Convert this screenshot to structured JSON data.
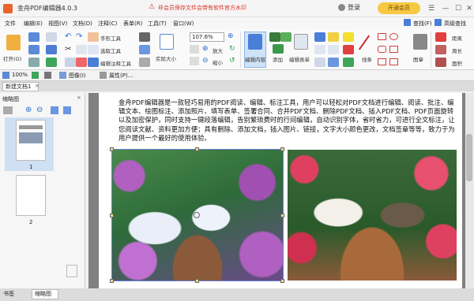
{
  "app": {
    "title": "金舟PDF编辑器4.0.3"
  },
  "watermark_notice": "非会员保存文件会带有软件官方水印",
  "header": {
    "login": "登录",
    "vip": "开通会员"
  },
  "menu": [
    "文件",
    "编辑(E)",
    "视图(V)",
    "文档(D)",
    "注释(C)",
    "表单(R)",
    "工具(T)",
    "窗口(W)"
  ],
  "menu_right": {
    "find": "查找(F)",
    "adv_find": "高级查找"
  },
  "toolbar": {
    "open": "打开(O)",
    "hand_tool": "手形工具",
    "select_tool": "选取工具",
    "comment_tool": "编辑注释工具",
    "actual_size": "实际大小",
    "zoom_value": "107.6%",
    "zoom_in": "放大",
    "zoom_out": "缩小",
    "edit_content": "编辑内容",
    "add": "添加",
    "edit_form": "编辑表单",
    "line": "线条",
    "stamp": "图章",
    "distance": "距离",
    "perimeter": "周长",
    "area": "面积"
  },
  "row2": {
    "zoom": "100%",
    "image": "图像(I)",
    "properties": "属性(P)..."
  },
  "tabs": {
    "doc": "新建文档1"
  },
  "sidebar": {
    "title": "缩略图",
    "page1": "1",
    "page2": "2"
  },
  "status": {
    "bookmarks": "书签",
    "thumbnails": "缩略图"
  },
  "doc_text": "金舟PDF编辑器是一款轻巧易用的PDF阅读、编辑、标注工具，用户可以轻松对PDF文档进行编辑、阅读、批注、编辑文本、绘图标注、添加照片、填写表单、签署合同、合并PDF文档、删除PDF文档、插入PDF文档、PDF页面旋转以及加密保护，同时支持一键段落编辑，告别繁琐费时的行间编辑，自动识别字体，省时省力，可进行全文标注，让您阅读文献、资料更加方便；具有删除、添加文档，插入图片、链接，文字大小颜色更改，文档签章等等，致力于为用户提供一个最好的使用体验。",
  "colors": {
    "accent": "#e8652c",
    "vip": "#f7c843",
    "notice": "#d7352b"
  }
}
